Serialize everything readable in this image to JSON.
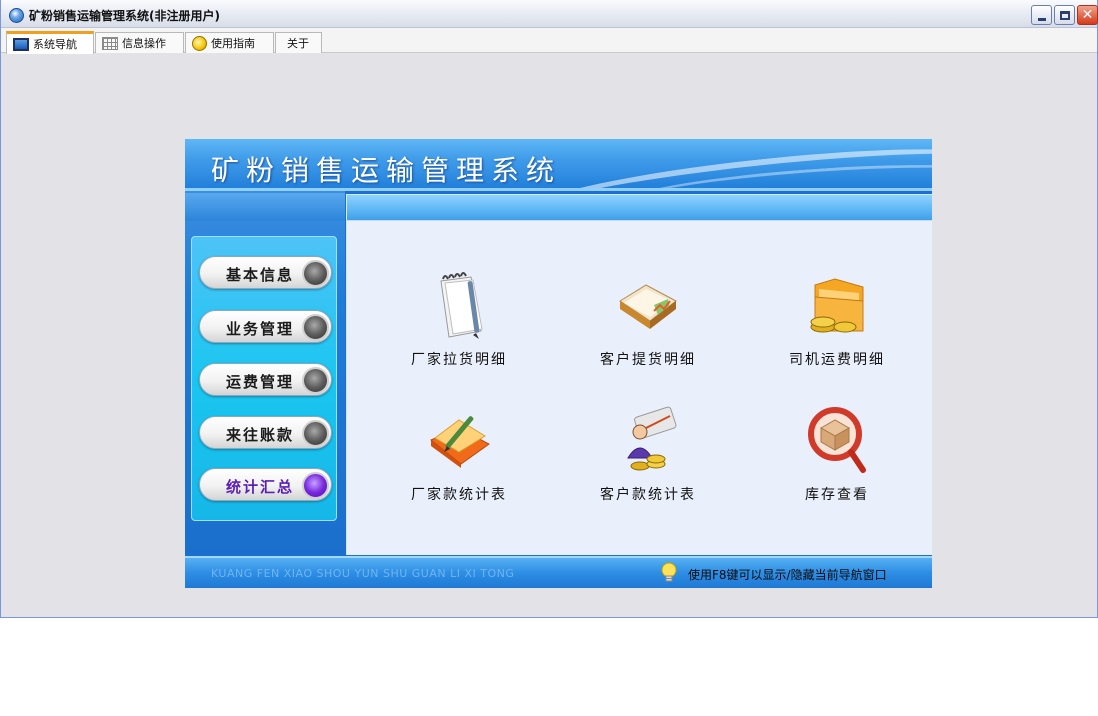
{
  "window": {
    "title": "矿粉销售运输管理系统(非注册用户)"
  },
  "tabs": [
    {
      "label": "系统导航",
      "icon": "monitor-icon",
      "active": true
    },
    {
      "label": "信息操作",
      "icon": "grid-icon",
      "active": false
    },
    {
      "label": "使用指南",
      "icon": "help-icon",
      "active": false
    },
    {
      "label": "关于",
      "icon": "",
      "active": false
    }
  ],
  "banner": {
    "title": "矿粉销售运输管理系统"
  },
  "menu": [
    {
      "label": "基本信息",
      "active": false
    },
    {
      "label": "业务管理",
      "active": false
    },
    {
      "label": "运费管理",
      "active": false
    },
    {
      "label": "来往账款",
      "active": false
    },
    {
      "label": "统计汇总",
      "active": true
    }
  ],
  "tiles": [
    {
      "label": "厂家拉货明细",
      "icon": "notebook-pen-icon"
    },
    {
      "label": "客户提货明细",
      "icon": "open-book-chart-icon"
    },
    {
      "label": "司机运费明细",
      "icon": "folder-coins-icon"
    },
    {
      "label": "厂家款统计表",
      "icon": "folder-pen-icon"
    },
    {
      "label": "客户款统计表",
      "icon": "user-coins-icon"
    },
    {
      "label": "库存查看",
      "icon": "box-magnifier-icon"
    }
  ],
  "footer": {
    "pinyin": "KUANG FEN XIAO SHOU YUN SHU GUAN LI XI TONG",
    "hint": "使用F8键可以显示/隐藏当前导航窗口",
    "hint_icon": "lightbulb-icon"
  },
  "colors": {
    "accent_blue": "#1e6fcf",
    "menu_cyan": "#1ac6f0",
    "active_purple": "#7a2be0",
    "content_bg": "#eaf0fb"
  }
}
